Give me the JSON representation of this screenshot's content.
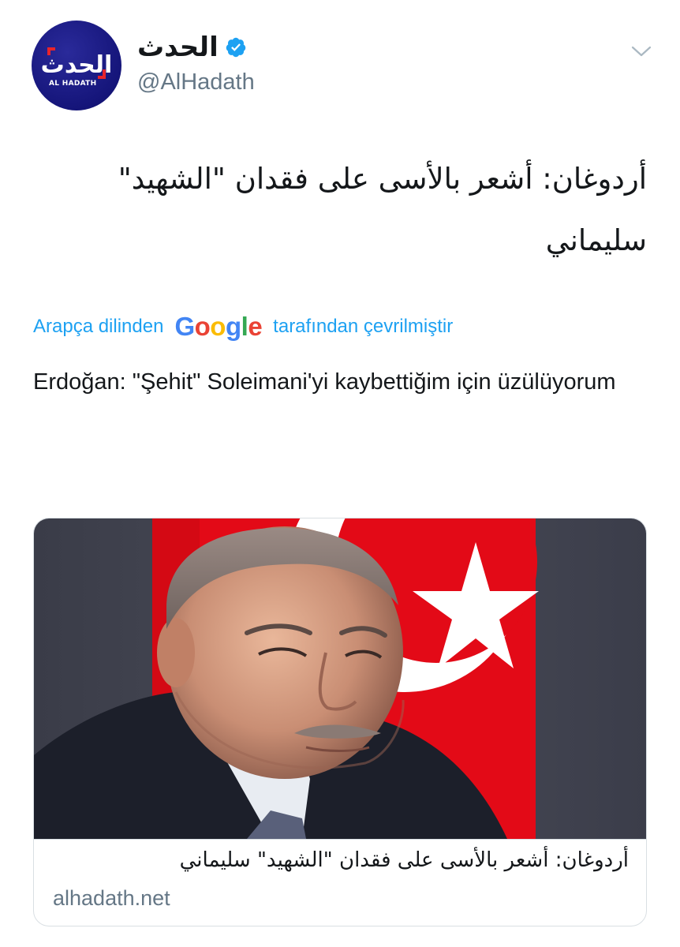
{
  "author": {
    "display_name": "الحدث",
    "handle": "@AlHadath",
    "verified": true,
    "avatar": {
      "logo_text": "الحدث",
      "caption": "AL HADATH",
      "background_color": "#15157a",
      "accent_color": "#e8242b"
    }
  },
  "menu": {
    "icon": "chevron-down-icon"
  },
  "tweet": {
    "text": "أردوغان: أشعر بالأسى على فقدان \"الشهيد\" سليماني",
    "translation": {
      "prefix": "Arapça dilinden",
      "provider": [
        "G",
        "o",
        "o",
        "g",
        "l",
        "e"
      ],
      "suffix": "tarafından çevrilmiştir",
      "text": "Erdoğan: \"Şehit\" Soleimani'yi kaybettiğim için üzülüyorum"
    }
  },
  "card": {
    "title": "أردوغان: أشعر بالأسى على فقدان \"الشهيد\" سليماني",
    "domain": "alhadath.net"
  },
  "colors": {
    "link_blue": "#1da1f2",
    "secondary_text": "#657786",
    "border": "#d9dfe3",
    "flag_red": "#e30a17"
  }
}
